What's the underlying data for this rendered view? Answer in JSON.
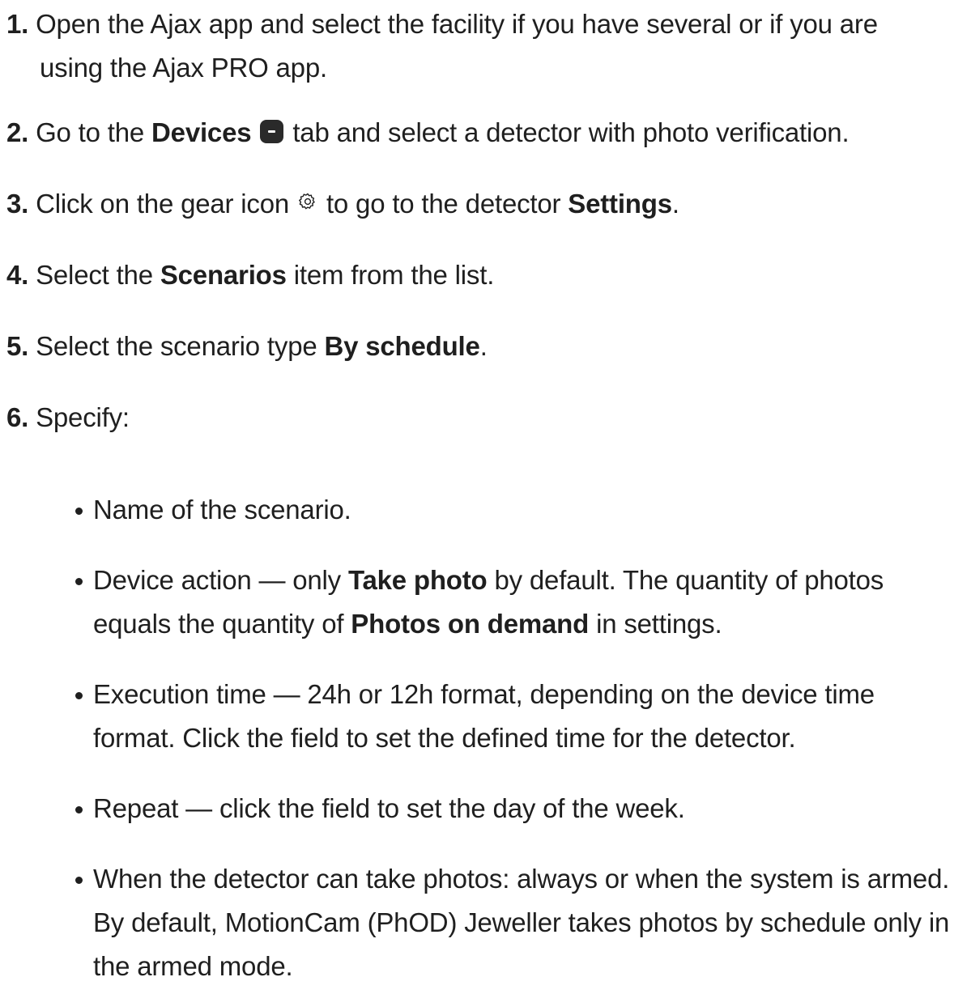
{
  "steps": [
    {
      "num": "1.",
      "text": "Open the Ajax app and select the facility if you have several or if you are using the Ajax PRO app."
    },
    {
      "num": "2.",
      "pre": "Go to the ",
      "bold": "Devices",
      "post": " tab and select a detector with photo verification.",
      "icon": "devices-tab-icon"
    },
    {
      "num": "3.",
      "pre": "Click on the gear icon ",
      "post_icon": " to go to the detector ",
      "bold": "Settings",
      "end": ".",
      "icon": "gear-icon"
    },
    {
      "num": "4.",
      "pre": "Select the ",
      "bold": "Scenarios",
      "post": " item from the list."
    },
    {
      "num": "5.",
      "pre": "Select the scenario type ",
      "bold": "By schedule",
      "post": "."
    },
    {
      "num": "6.",
      "text": "Specify:"
    }
  ],
  "bullets": [
    {
      "text": "Name of the scenario."
    },
    {
      "pre": "Device action — only ",
      "bold1": "Take photo",
      "mid": " by default. The quantity of photos equals the quantity of ",
      "bold2": "Photos on demand",
      "post": " in settings."
    },
    {
      "text": "Execution time — 24h or 12h format, depending on the device time format. Click the field to set the defined time for the detector."
    },
    {
      "text": "Repeat — click the field to set the day of the week."
    },
    {
      "text": "When the detector can take photos: always or when the system is armed. By default, MotionCam (PhOD) Jeweller takes photos by schedule only in the armed mode."
    }
  ]
}
